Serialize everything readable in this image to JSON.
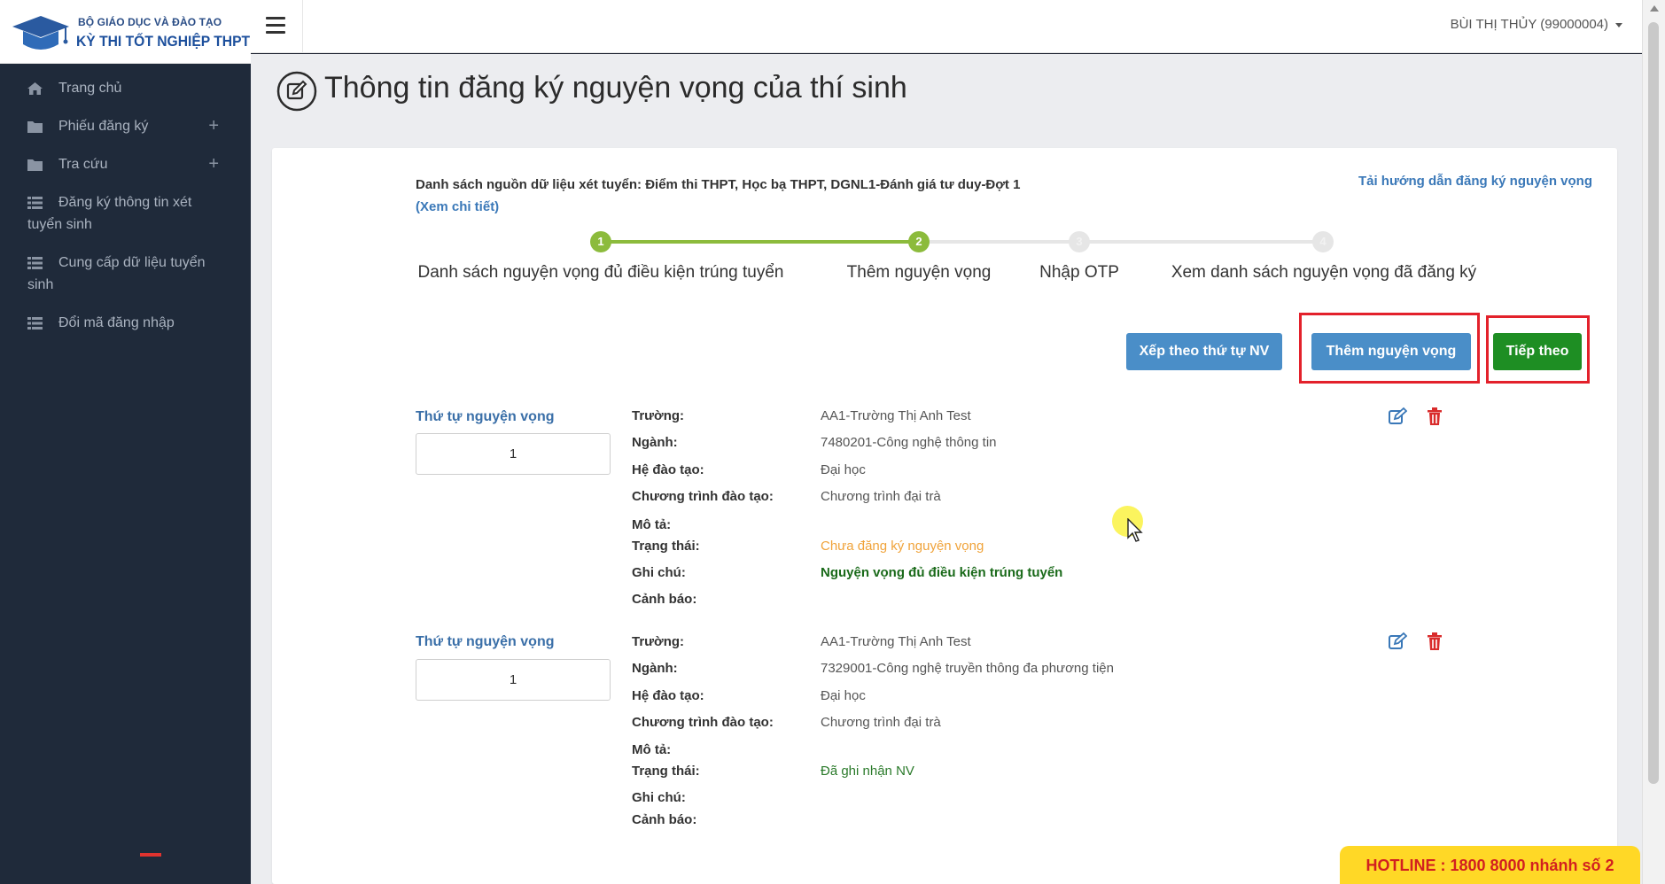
{
  "logo": {
    "line1": "BỘ GIÁO DỤC VÀ ĐÀO TẠO",
    "line2": "KỲ THI TỐT NGHIỆP THPT"
  },
  "sidebar": {
    "items": [
      {
        "label": "Trang chủ",
        "icon": "home-icon",
        "has_plus": false
      },
      {
        "label": "Phiếu đăng ký",
        "icon": "folder-icon",
        "has_plus": true
      },
      {
        "label": "Tra cứu",
        "icon": "folder-icon",
        "has_plus": true
      },
      {
        "label": "Đăng ký thông tin xét tuyển sinh",
        "icon": "list-icon",
        "has_plus": false
      },
      {
        "label": "Cung cấp dữ liệu tuyển sinh",
        "icon": "list-icon",
        "has_plus": false
      },
      {
        "label": "Đổi mã đăng nhập",
        "icon": "list-icon",
        "has_plus": false
      }
    ],
    "plus_symbol": "+"
  },
  "topbar": {
    "user": "BÙI THỊ THỦY (99000004)"
  },
  "page": {
    "title": "Thông tin đăng ký nguyện vọng của thí sinh",
    "source_prefix": "Danh sách nguồn dữ liệu xét tuyển: Điểm thi THPT, Học bạ THPT, DGNL1-Đánh giá tư duy-Đợt 1 ",
    "source_link": "(Xem chi tiết)",
    "guide_link": "Tải hướng dẫn đăng ký nguyện vọng"
  },
  "stepper": {
    "steps": [
      {
        "number": "1",
        "label": "Danh sách nguyện vọng đủ điều kiện trúng tuyển",
        "state": "done"
      },
      {
        "number": "2",
        "label": "Thêm nguyện vọng",
        "state": "active"
      },
      {
        "number": "3",
        "label": "Nhập OTP",
        "state": "pending"
      },
      {
        "number": "4",
        "label": "Xem danh sách nguyện vọng đã đăng ký",
        "state": "pending"
      }
    ],
    "colors": {
      "done": "#8cbb3c",
      "pending": "#e6e6e6"
    }
  },
  "actions": {
    "sort_label": "Xếp theo thứ tự NV",
    "add_label": "Thêm nguyện vọng",
    "next_label": "Tiếp theo"
  },
  "records": {
    "order_label": "Thứ tự nguyện vọng",
    "field_labels": {
      "school": "Trường:",
      "major": "Ngành:",
      "level": "Hệ đào tạo:",
      "program": "Chương trình đào tạo:",
      "description": "Mô tả:",
      "status": "Trạng thái:",
      "note": "Ghi chú:",
      "warning": "Cảnh báo:"
    },
    "items": [
      {
        "order": "1",
        "school": "AA1-Trường Thị Anh Test",
        "major": "7480201-Công nghệ thông tin",
        "level": "Đại học",
        "program": "Chương trình đại trà",
        "description": "",
        "status": "Chưa đăng ký nguyện vọng",
        "note": "Nguyện vọng đủ điều kiện trúng tuyển",
        "warning": ""
      },
      {
        "order": "1",
        "school": "AA1-Trường Thị Anh Test",
        "major": "7329001-Công nghệ truyền thông đa phương tiện",
        "level": "Đại học",
        "program": "Chương trình đại trà",
        "description": "",
        "status": "Đã ghi nhận NV",
        "note": "",
        "warning": ""
      }
    ]
  },
  "hotline": "HOTLINE : 1800 8000 nhánh số 2",
  "colors": {
    "accent_blue": "#4a8ec8",
    "accent_green": "#1e8e23",
    "highlight_red": "#e3212b",
    "sidebar_bg": "#1f2a3a"
  }
}
